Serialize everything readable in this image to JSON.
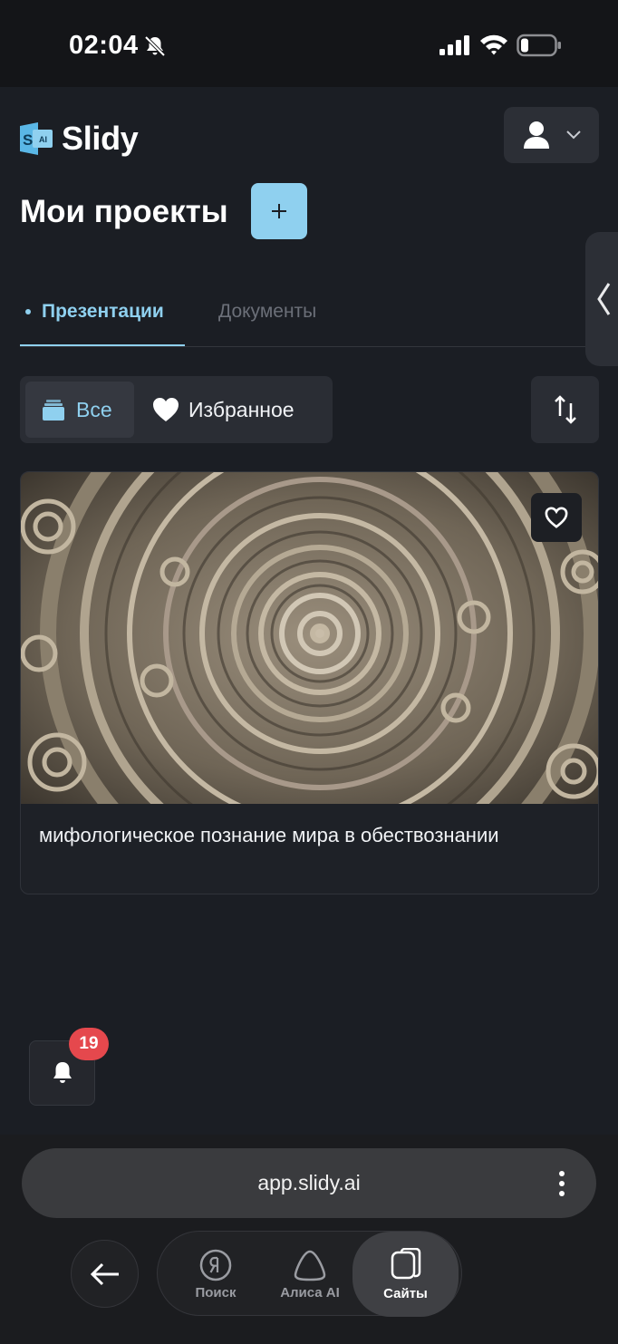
{
  "status_bar": {
    "time": "02:04"
  },
  "header": {
    "logo_text": "Slidy",
    "logo_badge": "S",
    "logo_badge_small": "AI"
  },
  "page": {
    "title": "Мои проекты",
    "add_label": "+"
  },
  "tabs": [
    {
      "label": "Презентации",
      "active": true
    },
    {
      "label": "Документы",
      "active": false
    }
  ],
  "filters": {
    "all_label": "Все",
    "favorites_label": "Избранное"
  },
  "projects": [
    {
      "title": "мифологическое познание мира в обествознании",
      "favorite": false
    }
  ],
  "notifications": {
    "count": "19"
  },
  "browser": {
    "url": "app.slidy.ai",
    "nav": [
      {
        "label": "Поиск",
        "icon": "yandex-search-icon"
      },
      {
        "label": "Алиса AI",
        "icon": "alice-icon"
      },
      {
        "label": "Сайты",
        "icon": "tabs-icon",
        "active": true
      }
    ]
  },
  "colors": {
    "accent": "#8fd0ef",
    "background": "#1b1e24",
    "badge": "#e5484d"
  }
}
